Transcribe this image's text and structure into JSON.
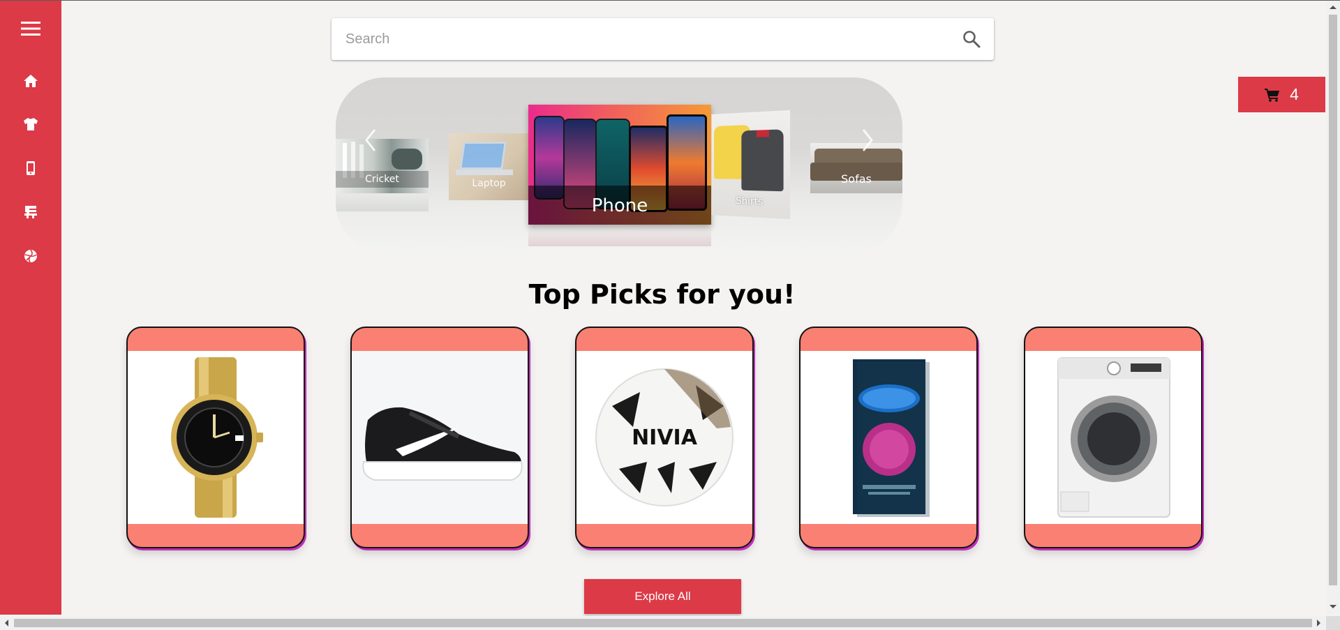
{
  "search": {
    "placeholder": "Search"
  },
  "cart": {
    "count": "4",
    "icon": "cart-icon"
  },
  "sidebar": {
    "accent": "#dc3a46",
    "items": [
      {
        "name": "menu",
        "icon": "hamburger-icon"
      },
      {
        "name": "home",
        "icon": "home-icon"
      },
      {
        "name": "clothing",
        "icon": "tshirt-icon"
      },
      {
        "name": "mobiles",
        "icon": "mobile-icon"
      },
      {
        "name": "furniture",
        "icon": "chair-icon"
      },
      {
        "name": "sports",
        "icon": "ball-icon"
      }
    ]
  },
  "carousel": {
    "slides": [
      "Cricket",
      "Laptop",
      "Phone",
      "Shirts",
      "Sofas"
    ],
    "active": "Phone"
  },
  "main": {
    "heading": "Top Picks for you!",
    "products": [
      {
        "name": "watch"
      },
      {
        "name": "shoe"
      },
      {
        "name": "football"
      },
      {
        "name": "durex"
      },
      {
        "name": "washing-machine"
      }
    ],
    "explore_label": "Explore All"
  }
}
